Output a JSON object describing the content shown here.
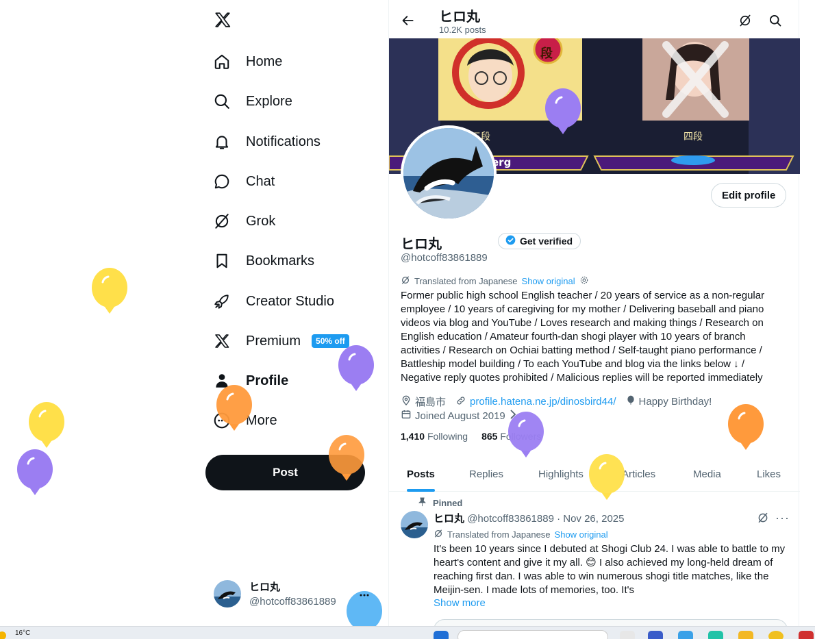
{
  "nav": {
    "items": [
      {
        "label": "Home",
        "icon": "home-icon"
      },
      {
        "label": "Explore",
        "icon": "search-icon"
      },
      {
        "label": "Notifications",
        "icon": "bell-icon"
      },
      {
        "label": "Chat",
        "icon": "chat-bubble-icon"
      },
      {
        "label": "Grok",
        "icon": "grok-icon"
      },
      {
        "label": "Bookmarks",
        "icon": "bookmark-icon"
      },
      {
        "label": "Creator Studio",
        "icon": "rocket-icon"
      },
      {
        "label": "Premium",
        "icon": "x-logo-icon",
        "badge": "50% off"
      },
      {
        "label": "Profile",
        "icon": "person-icon",
        "active": true
      },
      {
        "label": "More",
        "icon": "more-circle-icon"
      }
    ],
    "post_label": "Post",
    "account": {
      "name": "ヒロ丸",
      "handle": "@hotcoff83861889"
    }
  },
  "topbar": {
    "name": "ヒロ丸",
    "post_count": "10.2K posts"
  },
  "banner": {
    "left_rank": "三段",
    "left_name": "erg",
    "right_rank": "四段",
    "top_badge": "段"
  },
  "profile": {
    "edit_label": "Edit profile",
    "name": "ヒロ丸",
    "verify_label": "Get verified",
    "handle": "@hotcoff83861889",
    "translated_label": "Translated from Japanese",
    "show_original": "Show original",
    "bio": "Former public high school English teacher / 20 years of service as a non-regular employee / 10 years of caregiving for my mother / Delivering baseball and piano videos via blog and YouTube / Loves research and making things / Research on English education / Amateur fourth-dan shogi player with 10 years of branch activities / Research on Ochiai batting method / Self-taught piano performance / Battleship model building / To each YouTube and blog via the links below ↓ / Negative reply quotes prohibited / Malicious replies will be reported immediately",
    "location": "福島市",
    "website": "profile.hatena.ne.jp/dinosbird44/",
    "birthday": "Happy Birthday!",
    "joined": "Joined August 2019",
    "following_count": "1,410",
    "following_label": "Following",
    "followers_count": "865",
    "followers_label": "Followers"
  },
  "tabs": [
    "Posts",
    "Replies",
    "Highlights",
    "Articles",
    "Media",
    "Likes"
  ],
  "tweet": {
    "pinned_label": "Pinned",
    "name": "ヒロ丸",
    "handle_date": "@hotcoff83861889 · Nov 26, 2025",
    "translated_label": "Translated from Japanese",
    "show_original": "Show original",
    "text": "It's been 10 years since I debuted at Shogi Club 24. I was able to battle to my heart's content and give it my all. 😊 I also achieved my long-held dream of reaching first dan. I was able to win numerous shogi title matches, like the Meijin-sen. I made lots of memories, too. It's",
    "show_more": "Show more"
  },
  "taskbar": {
    "temperature": "16°C"
  },
  "colors": {
    "accent": "#1d9bf0",
    "text": "#0f1419",
    "muted": "#536471",
    "post_button": "#0f1419"
  }
}
